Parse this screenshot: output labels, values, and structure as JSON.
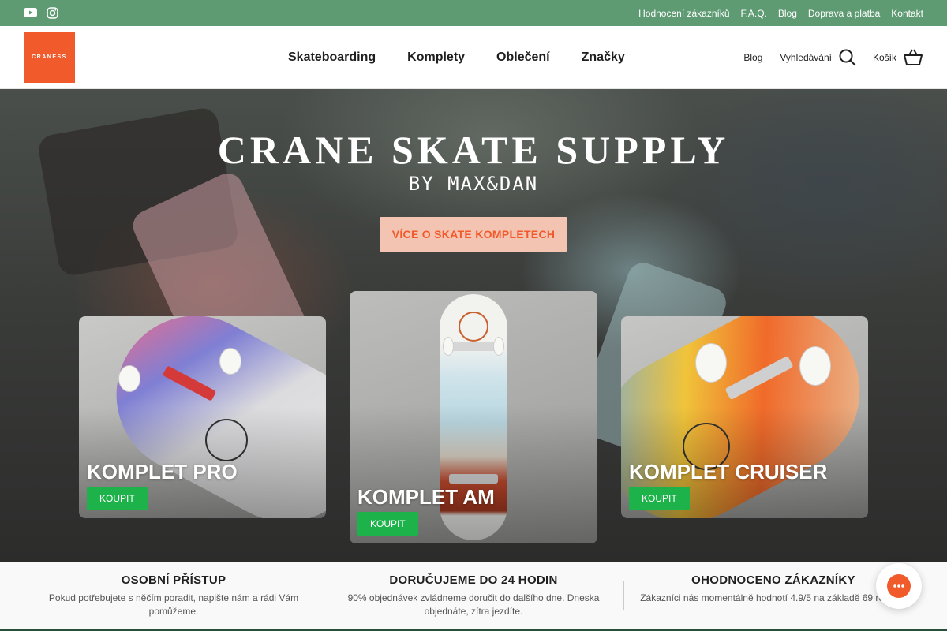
{
  "topbar": {
    "links": [
      "Hodnocení zákazníků",
      "F.A.Q.",
      "Blog",
      "Doprava a platba",
      "Kontakt"
    ],
    "social_icons": [
      "youtube-icon",
      "instagram-icon"
    ],
    "background_color": "#5e9a72"
  },
  "header": {
    "logo_text": "CRANESS",
    "logo_color": "#f15a2b",
    "nav": [
      "Skateboarding",
      "Komplety",
      "Oblečení",
      "Značky"
    ],
    "blog_label": "Blog",
    "search_label": "Vyhledávání",
    "cart_label": "Košík"
  },
  "hero": {
    "title": "CRANE SKATE SUPPLY",
    "subtitle": "BY MAX&DAN",
    "cta_label": "VÍCE O SKATE KOMPLETECH",
    "cta_bg_color": "#f4c4b3",
    "cta_text_color": "#f15a2b"
  },
  "products": [
    {
      "title": "KOMPLET PRO",
      "button": "KOUPIT"
    },
    {
      "title": "KOMPLET AM",
      "button": "KOUPIT"
    },
    {
      "title": "KOMPLET CRUISER",
      "button": "KOUPIT"
    }
  ],
  "buy_button_color": "#1db24a",
  "features": [
    {
      "title": "OSOBNÍ PŘÍSTUP",
      "text": "Pokud potřebujete s něčím poradit, napište nám a rádi Vám pomůžeme."
    },
    {
      "title": "DORUČUJEME DO 24 HODIN",
      "text": "90% objednávek zvládneme doručit do dalšího dne. Dneska objednáte, zítra jezdíte."
    },
    {
      "title": "OHODNOCENO ZÁKAZNÍKY",
      "text": "Zákazníci nás momentálně hodnotí 4.9/5 na základě 69 recenzí"
    }
  ],
  "chat_icon": "chat-bubble-icon"
}
